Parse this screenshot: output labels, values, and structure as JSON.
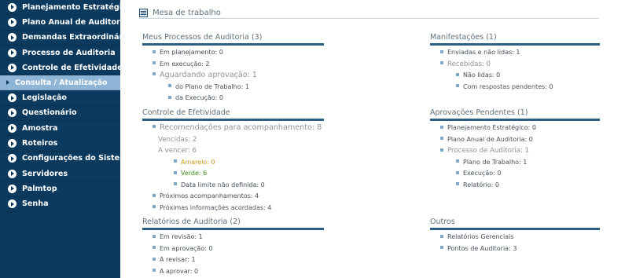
{
  "sidebar": {
    "items": [
      {
        "label": "Planejamento Estratégico"
      },
      {
        "label": "Plano Anual de Auditoria"
      },
      {
        "label": "Demandas Extraordinárias"
      },
      {
        "label": "Processo de Auditoria"
      },
      {
        "label": "Controle de Efetividade"
      }
    ],
    "active_sub": {
      "label": "Consulta / Atualização"
    },
    "items_after": [
      {
        "label": "Legislação"
      },
      {
        "label": "Questionário"
      },
      {
        "label": "Amostra"
      },
      {
        "label": "Roteiros"
      },
      {
        "label": "Configurações do Sistema"
      },
      {
        "label": "Servidores"
      },
      {
        "label": "Palmtop"
      },
      {
        "label": "Senha"
      }
    ]
  },
  "header": {
    "title": "Mesa de trabalho"
  },
  "sections": {
    "processos": {
      "title": "Meus Processos de Auditoria (3)",
      "items": [
        "Em planejamento: 0",
        "Em execução: 2",
        "Aguardando aprovação: 1",
        "do Plano de Trabalho: 1",
        "da Execução: 0"
      ]
    },
    "controle": {
      "title": "Controle de Efetividade",
      "items": [
        "Recomendações para acompanhamento: 8",
        "Vencidas: 2",
        "A vencer: 6",
        "Amarelo: 0",
        "Verde: 6",
        "Data limite não definida: 0",
        "Próximos acompanhamentos: 4",
        "Próximas informações acordadas: 4"
      ]
    },
    "relatorios": {
      "title": "Relatórios de Auditoria (2)",
      "items": [
        "Em revisão: 1",
        "Em aprovação: 0",
        "A revisar: 1",
        "A aprovar: 0"
      ]
    },
    "manifestacoes": {
      "title": "Manifestações (1)",
      "items": [
        "Enviadas e não lidas: 1",
        "Recebidas: 0",
        "Não lidas: 0",
        "Com respostas pendentes: 0"
      ]
    },
    "aprovacoes": {
      "title": "Aprovações Pendentes (1)",
      "items": [
        "Planejamento Estratégico: 0",
        "Plano Anual de Auditoria: 0",
        "Processo de Auditoria: 1",
        "Plano de Trabalho: 1",
        "Execução: 0",
        "Relatório: 0"
      ]
    },
    "outros": {
      "title": "Outros",
      "items": [
        "Relatórios Gerenciais",
        "Pontos de Auditoria: 3"
      ]
    }
  },
  "colors": {
    "sidebar_bg": "#0c3a5f",
    "active_sub_bg": "#8fb5d6",
    "section_rule": "#2c5f86",
    "overdue": "#cc2222",
    "amber": "#c99a1a",
    "green": "#3d8a1e"
  }
}
